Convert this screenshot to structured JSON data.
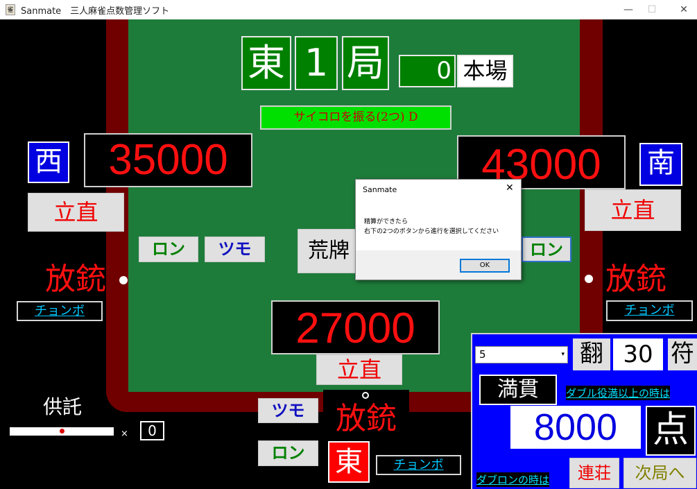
{
  "window": {
    "title": "Sanmate　三人麻雀点数管理ソフト",
    "min": "—",
    "max": "☐",
    "close": "✕"
  },
  "round": {
    "wind": "東",
    "number": "1",
    "kyoku": "局",
    "honba_count": "0",
    "honba_label": "本場"
  },
  "dice_button": "サイコロを振る(2つ) D",
  "players": {
    "west": {
      "seat": "西",
      "score": "35000",
      "riichi": "立直",
      "ron": "ロン",
      "tsumo": "ツモ",
      "houju": "放銃",
      "chombo": "チョンボ"
    },
    "south": {
      "seat": "南",
      "score": "43000",
      "riichi": "立直",
      "ron": "ロン",
      "houju": "放銃",
      "chombo": "チョンボ"
    },
    "east": {
      "seat": "東",
      "score": "27000",
      "riichi": "立直",
      "ron": "ロン",
      "tsumo": "ツモ",
      "houju": "放銃",
      "chombo": "チョンボ"
    }
  },
  "ryuukyoku_button": "荒牌",
  "kyoutaku": {
    "label": "供託",
    "times": "×",
    "count": "0"
  },
  "dialog": {
    "title": "Sanmate",
    "close": "✕",
    "line1": "精算ができたら",
    "line2": "右下の2つのボタンから進行を選択してください",
    "ok": "OK"
  },
  "scoring": {
    "han_value": "5",
    "han_label": "翻",
    "fu_value": "30",
    "fu_label": "符",
    "mangan": "満貫",
    "double_yakuman_link": "ダブル役満以上の時は",
    "points": "8000",
    "points_label": "点",
    "double_ron_link": "ダブロンの時は",
    "renchan": "連荘",
    "next_round": "次局へ"
  }
}
